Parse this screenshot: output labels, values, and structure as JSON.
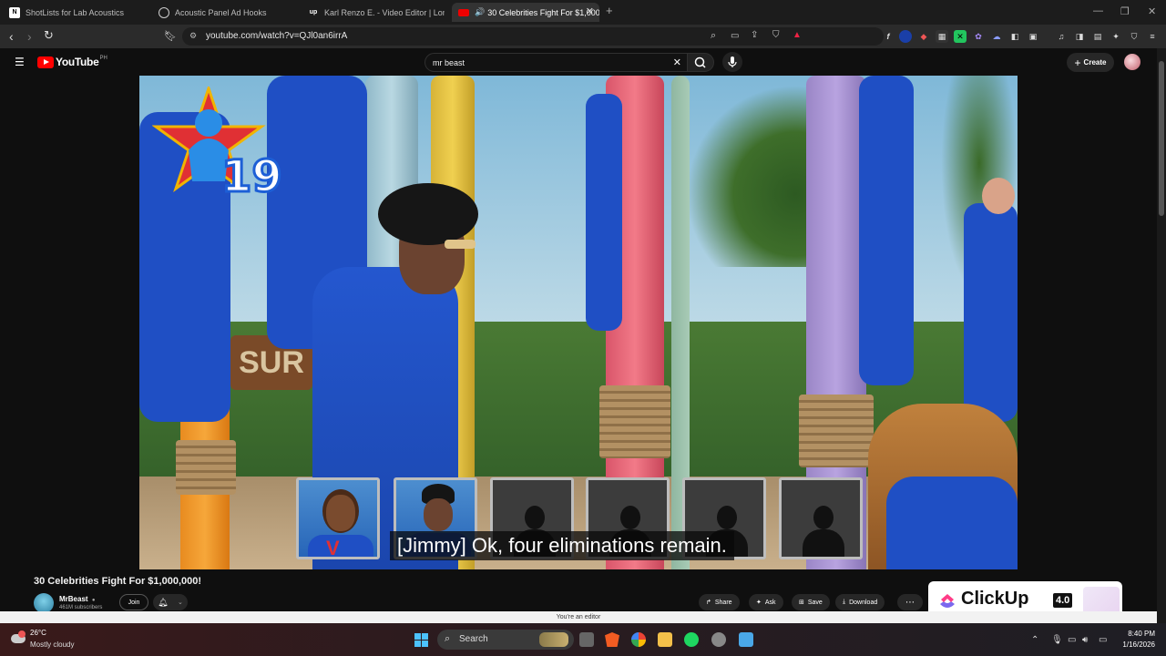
{
  "browser": {
    "tabs": [
      {
        "title": "ShotLists for Lab Acoustics",
        "icon": "notion-icon"
      },
      {
        "title": "Acoustic Panel Ad Hooks",
        "icon": "chatgpt-icon"
      },
      {
        "title": "Karl Renzo E. - Video Editor | Long &",
        "icon": "upwork-icon"
      },
      {
        "title": "30 Celebrities Fight For $1,000",
        "icon": "youtube-icon",
        "active": true
      }
    ],
    "url": "youtube.com/watch?v=QJl0an6irrA"
  },
  "youtube": {
    "logo_text": "YouTube",
    "logo_region": "PH",
    "search_value": "mr beast",
    "create_label": "Create"
  },
  "video": {
    "subtitle": "[Jimmy] Ok, four eliminations remain.",
    "counter_number": "19",
    "sign_text": "SUR"
  },
  "info": {
    "title": "30 Celebrities Fight For $1,000,000!",
    "channel_name": "MrBeast",
    "subscribers": "461M subscribers",
    "join_label": "Join",
    "share_label": "Share",
    "ask_label": "Ask",
    "save_label": "Save",
    "download_label": "Download",
    "ad_brand": "ClickUp",
    "ad_version": "4.0"
  },
  "editor_banner": "You're an editor",
  "taskbar": {
    "temperature": "26°C",
    "weather": "Mostly cloudy",
    "search_label": "Search",
    "time": "8:40 PM",
    "date": "1/16/2026"
  }
}
